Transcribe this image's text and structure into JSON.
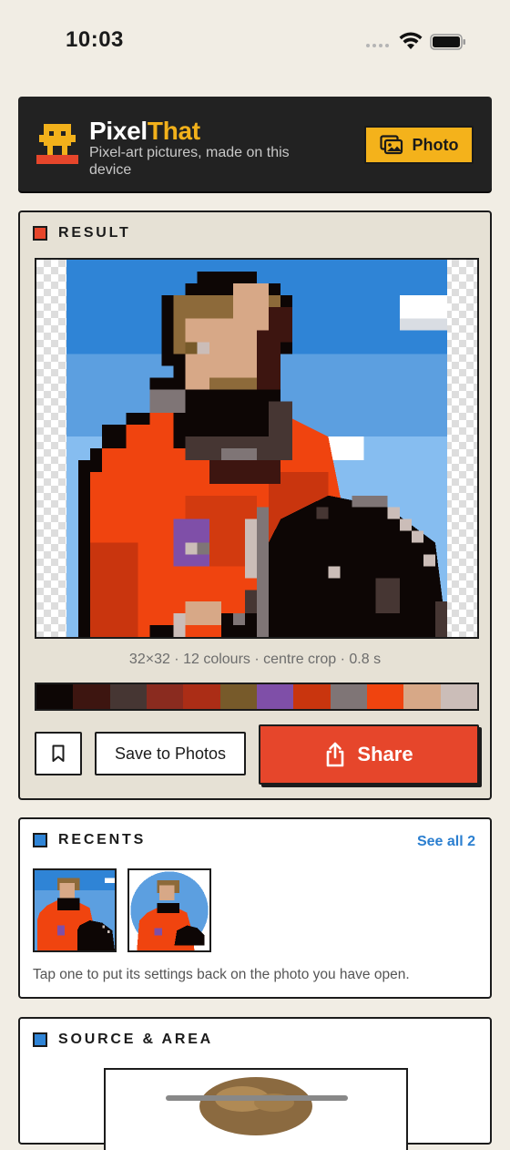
{
  "status_bar": {
    "time": "10:03"
  },
  "header": {
    "app_name_part1": "Pixel",
    "app_name_part2": "That",
    "subtitle": "Pixel-art pictures, made on this device",
    "photo_button_label": "Photo"
  },
  "result": {
    "section_label": "RESULT",
    "meta": "32×32 · 12 colours · centre crop · 0.8 s",
    "palette": [
      "#0d0605",
      "#3d1510",
      "#463633",
      "#8a2b1f",
      "#ab2d16",
      "#775a2a",
      "#7f4fa8",
      "#c9350e",
      "#7f7576",
      "#f0440f",
      "#d7a887",
      "#cbbdb8"
    ],
    "save_label": "Save to Photos",
    "share_label": "Share"
  },
  "recents": {
    "section_label": "RECENTS",
    "see_all_label": "See all 2",
    "note": "Tap one to put its settings back on the photo you have open."
  },
  "source": {
    "section_label": "SOURCE & AREA"
  },
  "colors": {
    "accent_red": "#e6462b",
    "accent_yellow": "#f4b21b",
    "link_blue": "#2b7fd0",
    "sky_blue": "#2f84d6"
  }
}
